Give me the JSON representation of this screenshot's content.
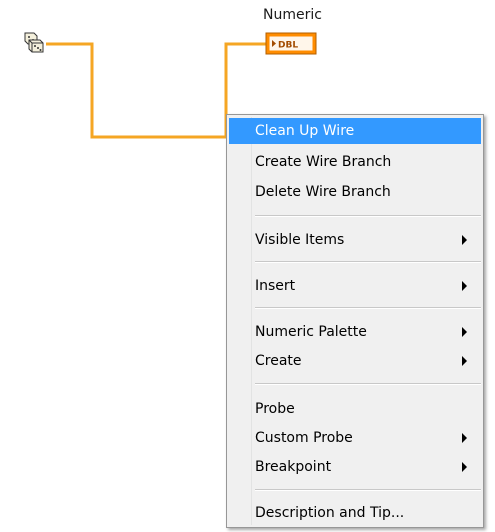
{
  "diagram": {
    "random_node": {
      "icon": "dice-icon"
    },
    "indicator": {
      "label": "Numeric",
      "terminal_text": "DBL",
      "terminal_color": "#ff8c00"
    },
    "wire_color": "#f5a623"
  },
  "context_menu": {
    "items": [
      {
        "label": "Clean Up Wire",
        "highlighted": true,
        "submenu": false
      },
      {
        "label": "Create Wire Branch",
        "highlighted": false,
        "submenu": false
      },
      {
        "label": "Delete Wire Branch",
        "highlighted": false,
        "submenu": false
      },
      {
        "label": "Visible Items",
        "highlighted": false,
        "submenu": true
      },
      {
        "label": "Insert",
        "highlighted": false,
        "submenu": true
      },
      {
        "label": "Numeric Palette",
        "highlighted": false,
        "submenu": true
      },
      {
        "label": "Create",
        "highlighted": false,
        "submenu": true
      },
      {
        "label": "Probe",
        "highlighted": false,
        "submenu": false
      },
      {
        "label": "Custom Probe",
        "highlighted": false,
        "submenu": true
      },
      {
        "label": "Breakpoint",
        "highlighted": false,
        "submenu": true
      },
      {
        "label": "Description and Tip...",
        "highlighted": false,
        "submenu": false
      }
    ],
    "highlight_color": "#3399ff"
  }
}
